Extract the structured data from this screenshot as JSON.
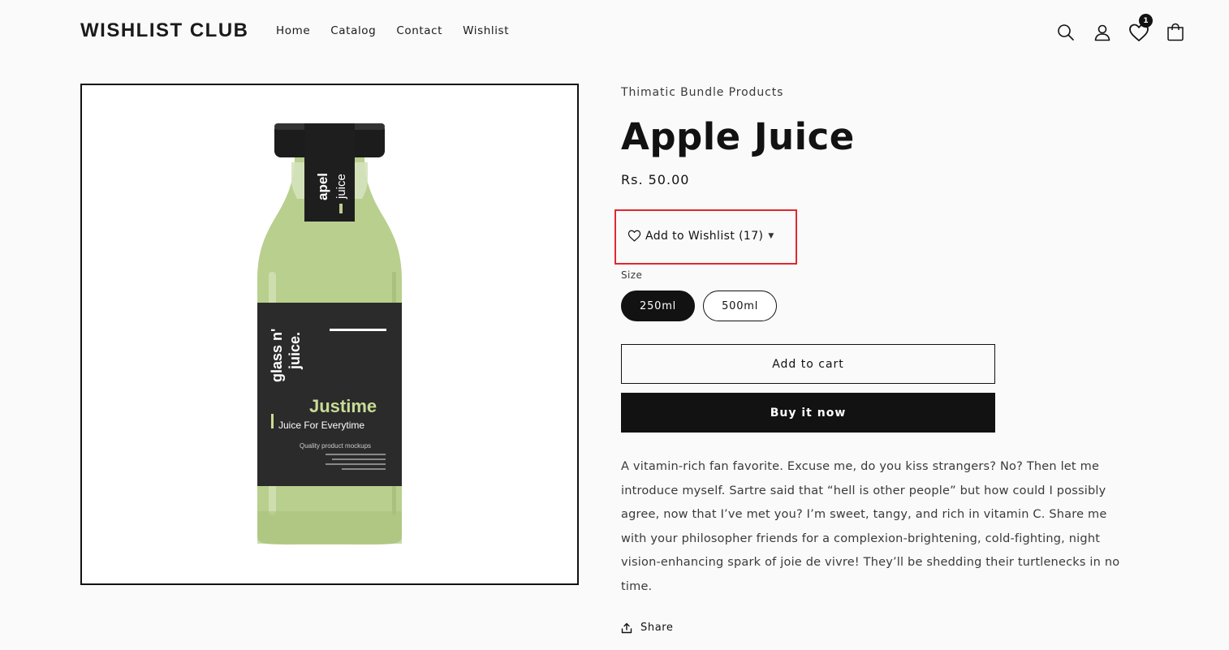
{
  "header": {
    "logo": "WISHLIST CLUB",
    "nav": [
      "Home",
      "Catalog",
      "Contact",
      "Wishlist"
    ],
    "wishlist_count": "1"
  },
  "product": {
    "vendor": "Thimatic Bundle Products",
    "title": "Apple Juice",
    "price": "Rs. 50.00",
    "wishlist_label": "Add to Wishlist (17)",
    "size_label": "Size",
    "sizes": [
      "250ml",
      "500ml"
    ],
    "selected_size": "250ml",
    "add_to_cart": "Add to cart",
    "buy_now": "Buy it now",
    "description": "A vitamin-rich fan favorite. Excuse me, do you kiss strangers? No? Then let me introduce myself. Sartre said that “hell is other people” but how could I possibly agree, now that I’ve met you? I’m sweet, tangy, and rich in vitamin C. Share me with your philosopher friends for a complexion-brightening, cold-fighting, night vision-enhancing spark of joie de vivre! They’ll be shedding their turtlenecks in no time.",
    "share": "Share"
  },
  "bottle": {
    "cap_label_1": "apel",
    "cap_label_2": "juice",
    "brand_vertical_1": "glass n'",
    "brand_vertical_2": "juice.",
    "name": "Justime",
    "tagline": "Juice For Everytime",
    "small": "Quality product mockups"
  },
  "colors": {
    "accent": "#121212",
    "highlight": "#e0282e",
    "juice": "#b9cf8e",
    "label": "#2b2b2b"
  }
}
